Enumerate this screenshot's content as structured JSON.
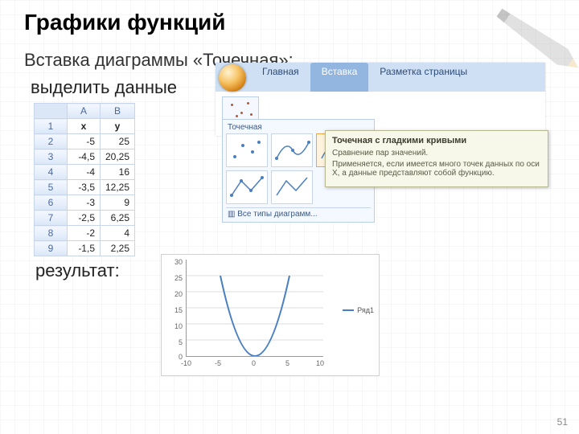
{
  "title": "Графики функций",
  "subtitle": "Вставка диаграммы «Точечная»:",
  "label_select": "выделить данные",
  "label_result": "результат:",
  "page_number": "51",
  "ribbon": {
    "tabs": [
      "Главная",
      "Вставка",
      "Разметка страницы"
    ],
    "active_tab_index": 1,
    "scatter_button_label": "Точечная",
    "gallery_caption": "Точечная",
    "all_types_link": "Все типы диаграмм..."
  },
  "tooltip": {
    "title": "Точечная с гладкими кривыми",
    "line1": "Сравнение пар значений.",
    "line2": "Применяется, если имеется много точек данных по оси X, а данные представляют собой функцию."
  },
  "sheet": {
    "cols": [
      "A",
      "B"
    ],
    "headers": [
      "x",
      "y"
    ],
    "rows": [
      {
        "n": "1",
        "a": "x",
        "b": "y"
      },
      {
        "n": "2",
        "a": "-5",
        "b": "25"
      },
      {
        "n": "3",
        "a": "-4,5",
        "b": "20,25"
      },
      {
        "n": "4",
        "a": "-4",
        "b": "16"
      },
      {
        "n": "5",
        "a": "-3,5",
        "b": "12,25"
      },
      {
        "n": "6",
        "a": "-3",
        "b": "9"
      },
      {
        "n": "7",
        "a": "-2,5",
        "b": "6,25"
      },
      {
        "n": "8",
        "a": "-2",
        "b": "4"
      },
      {
        "n": "9",
        "a": "-1,5",
        "b": "2,25"
      }
    ]
  },
  "chart_data": {
    "type": "line",
    "title": "",
    "xlabel": "",
    "ylabel": "",
    "x": [
      -10,
      -5,
      0,
      5,
      10
    ],
    "series": [
      {
        "name": "Ряд1",
        "x": [
          -5,
          -4.5,
          -4,
          -3.5,
          -3,
          -2.5,
          -2,
          -1.5,
          -1,
          -0.5,
          0,
          0.5,
          1,
          1.5,
          2,
          2.5,
          3,
          3.5,
          4,
          4.5,
          5
        ],
        "y": [
          25,
          20.25,
          16,
          12.25,
          9,
          6.25,
          4,
          2.25,
          1,
          0.25,
          0,
          0.25,
          1,
          2.25,
          4,
          6.25,
          9,
          12.25,
          16,
          20.25,
          25
        ]
      }
    ],
    "xlim": [
      -10,
      10
    ],
    "ylim": [
      0,
      30
    ],
    "yticks": [
      0,
      5,
      10,
      15,
      20,
      25,
      30
    ],
    "xticks": [
      -10,
      -5,
      0,
      5,
      10
    ],
    "legend": "Ряд1"
  }
}
